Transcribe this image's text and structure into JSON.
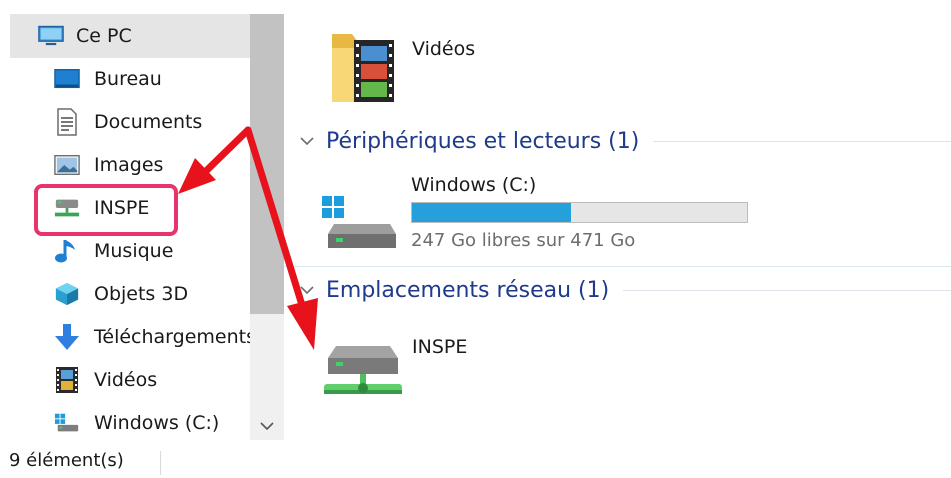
{
  "nav": {
    "root": {
      "label": "Ce PC",
      "icon": "monitor-icon"
    },
    "items": [
      {
        "label": "Bureau",
        "icon": "desktop-icon"
      },
      {
        "label": "Documents",
        "icon": "document-icon"
      },
      {
        "label": "Images",
        "icon": "picture-icon"
      },
      {
        "label": "INSPE",
        "icon": "network-drive-icon",
        "highlighted": true
      },
      {
        "label": "Musique",
        "icon": "music-note-icon"
      },
      {
        "label": "Objets 3D",
        "icon": "cube-icon"
      },
      {
        "label": "Téléchargements",
        "icon": "download-arrow-icon"
      },
      {
        "label": "Vidéos",
        "icon": "film-icon"
      },
      {
        "label": "Windows (C:)",
        "icon": "windows-drive-icon"
      }
    ]
  },
  "status": {
    "count": "9 élément(s)"
  },
  "content": {
    "folder_tile": {
      "label": "Vidéos",
      "icon": "video-folder-icon"
    },
    "groups": [
      {
        "title": "Périphériques et lecteurs (1)",
        "items": [
          {
            "label": "Windows (C:)",
            "icon": "windows-drive-icon",
            "free_text": "247 Go libres sur 471 Go",
            "used_fraction": 0.476
          }
        ]
      },
      {
        "title": "Emplacements réseau (1)",
        "items": [
          {
            "label": "INSPE",
            "icon": "network-drive-icon"
          }
        ]
      }
    ]
  },
  "colors": {
    "accent_blue": "#26a0da",
    "group_header": "#1e3a8a",
    "highlight_box": "#e8336b",
    "annotation_arrow": "#e8121c",
    "selection_bg": "#e5e5e5"
  }
}
